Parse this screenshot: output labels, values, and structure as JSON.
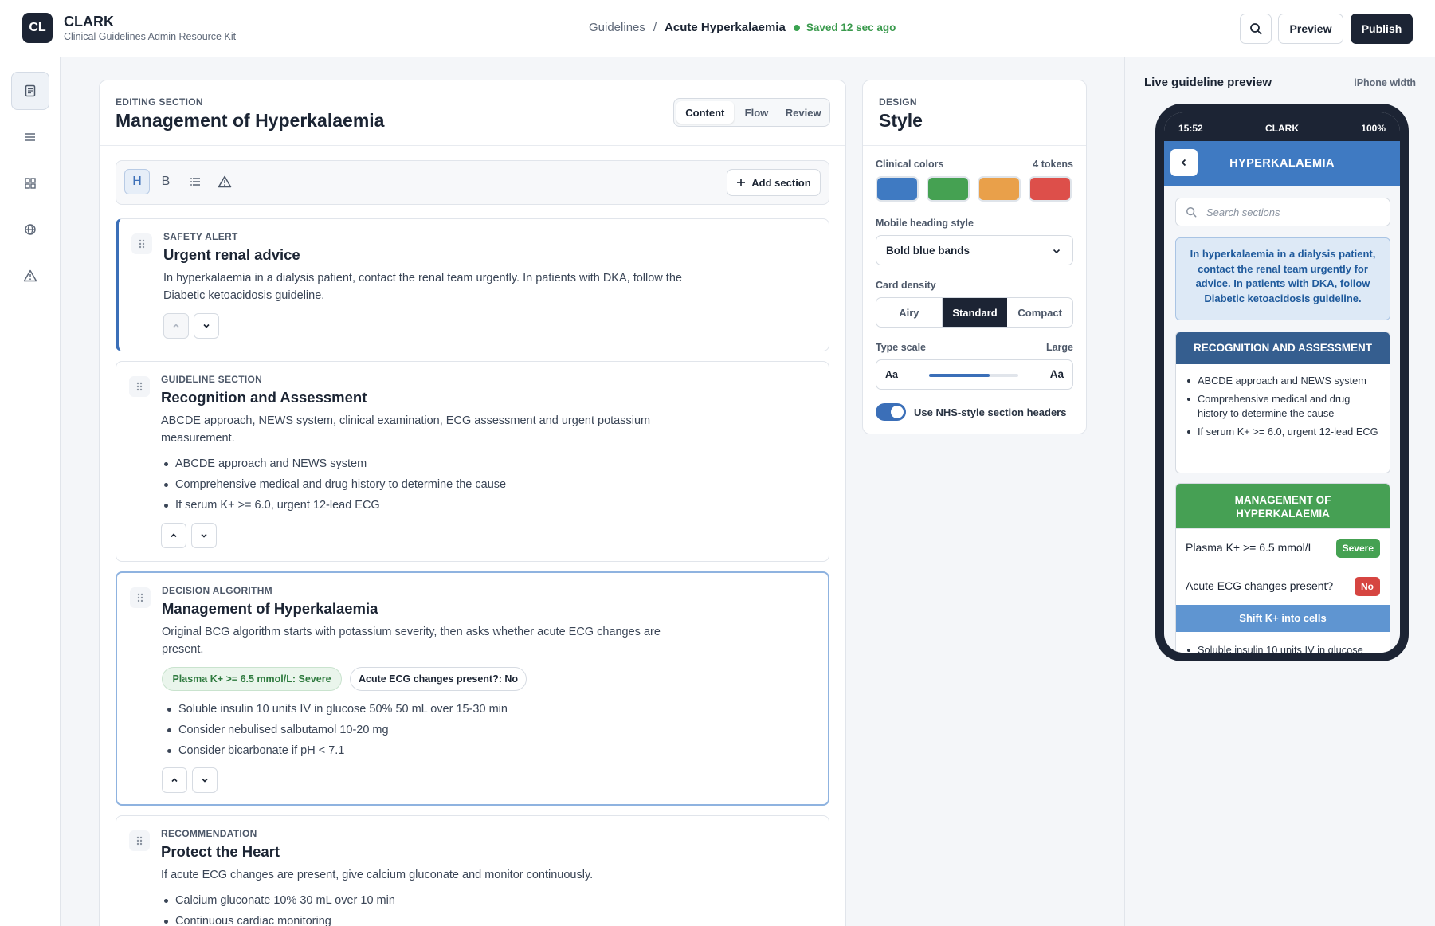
{
  "header": {
    "logo_text": "CL",
    "brand_name": "CLARK",
    "brand_subtitle": "Clinical Guidelines Admin Resource Kit",
    "breadcrumb_parent": "Guidelines",
    "breadcrumb_separator": "/",
    "breadcrumb_current": "Acute Hyperkalaemia",
    "saved_status": "Saved 12 sec ago",
    "preview_label": "Preview",
    "publish_label": "Publish"
  },
  "sidebar": {
    "icons": [
      "document-icon",
      "menu-icon",
      "grid-icon",
      "globe-icon",
      "warning-icon"
    ]
  },
  "editor": {
    "eyebrow": "EDITING SECTION",
    "title": "Management of Hyperkalaemia",
    "tabs": [
      "Content",
      "Flow",
      "Review"
    ],
    "active_tab": "Content",
    "toolbar": {
      "heading_label": "H",
      "bold_label": "B",
      "add_section_label": "Add section"
    },
    "sections": [
      {
        "eyebrow": "SAFETY ALERT",
        "title": "Urgent renal advice",
        "body": "In hyperkalaemia in a dialysis patient, contact the renal team urgently. In patients with DKA, follow the Diabetic ketoacidosis guideline."
      },
      {
        "eyebrow": "GUIDELINE SECTION",
        "title": "Recognition and Assessment",
        "body": "ABCDE approach, NEWS system, clinical examination, ECG assessment and urgent potassium measurement.",
        "bullets": [
          "ABCDE approach and NEWS system",
          "Comprehensive medical and drug history to determine the cause",
          "If serum K+ >= 6.0, urgent 12-lead ECG"
        ]
      },
      {
        "eyebrow": "DECISION ALGORITHM",
        "title": "Management of Hyperkalaemia",
        "body": "Original BCG algorithm starts with potassium severity, then asks whether acute ECG changes are present.",
        "chips": [
          "Plasma K+ >= 6.5 mmol/L: Severe",
          "Acute ECG changes present?: No"
        ],
        "bullets": [
          "Soluble insulin 10 units IV in glucose 50% 50 mL over 15-30 min",
          "Consider nebulised salbutamol 10-20 mg",
          "Consider bicarbonate if pH < 7.1"
        ]
      },
      {
        "eyebrow": "RECOMMENDATION",
        "title": "Protect the Heart",
        "body": "If acute ECG changes are present, give calcium gluconate and monitor continuously.",
        "bullets": [
          "Calcium gluconate 10% 30 mL over 10 min",
          "Continuous cardiac monitoring"
        ]
      }
    ]
  },
  "design": {
    "eyebrow": "DESIGN",
    "title": "Style",
    "clinical_colors_label": "Clinical colors",
    "tokens_label": "4 tokens",
    "swatches": [
      "#3f7ac2",
      "#45a152",
      "#e9a04a",
      "#dd4f4a"
    ],
    "heading_style_label": "Mobile heading style",
    "heading_style_value": "Bold blue bands",
    "density_label": "Card density",
    "density_options": [
      "Airy",
      "Standard",
      "Compact"
    ],
    "density_selected": "Standard",
    "type_scale_label": "Type scale",
    "type_scale_right": "Large",
    "type_small": "Aa",
    "type_large": "Aa",
    "type_scale_level": 0.68,
    "toggle_label": "Use NHS-style section headers",
    "toggle_on": true
  },
  "preview": {
    "title": "Live guideline preview",
    "width_label": "iPhone width",
    "status_time": "15:52",
    "status_app": "CLARK",
    "status_battery": "100%",
    "app_title": "HYPERKALAEMIA",
    "search_placeholder": "Search sections",
    "alert_text": "In hyperkalaemia in a dialysis patient, contact the renal team urgently for advice. In patients with DKA, follow Diabetic ketoacidosis guideline.",
    "recognition_band": "RECOGNITION AND ASSESSMENT",
    "recognition_bullets": [
      "ABCDE approach and NEWS system",
      "Comprehensive medical and drug history to determine the cause",
      "If serum K+ >= 6.0, urgent 12-lead ECG"
    ],
    "management_band": "MANAGEMENT OF HYPERKALAEMIA",
    "decision_rows": [
      {
        "text": "Plasma K+ >= 6.5 mmol/L",
        "badge": "Severe",
        "badge_color": "#45a152"
      },
      {
        "text": "Acute ECG changes present?",
        "badge": "No",
        "badge_color": "#d64541"
      }
    ],
    "shift_band": "Shift K+ into cells",
    "shift_bullet": "Soluble insulin 10 units IV in glucose"
  }
}
